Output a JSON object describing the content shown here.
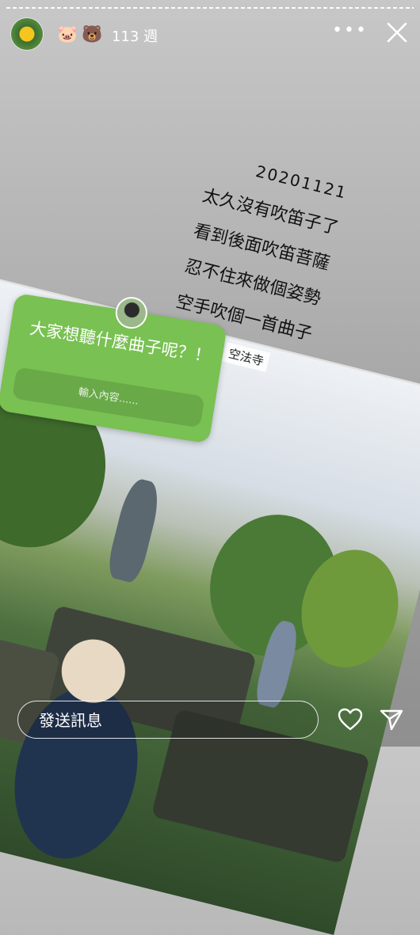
{
  "header": {
    "emoji_1": "🐷",
    "emoji_2": "🐻",
    "time_ago": "113 週",
    "more_label": "•••"
  },
  "caption": {
    "date": "20201121",
    "lines": [
      "太久沒有吹笛子了",
      "看到後面吹笛菩薩",
      "忍不住來做個姿勢",
      "空手吹個一首曲子"
    ]
  },
  "question_sticker": {
    "question": "大家想聽什麼曲子呢？！",
    "placeholder": "輸入內容......",
    "color": "#78c152"
  },
  "location_tag": "空法寺",
  "footer": {
    "message_placeholder": "發送訊息"
  }
}
